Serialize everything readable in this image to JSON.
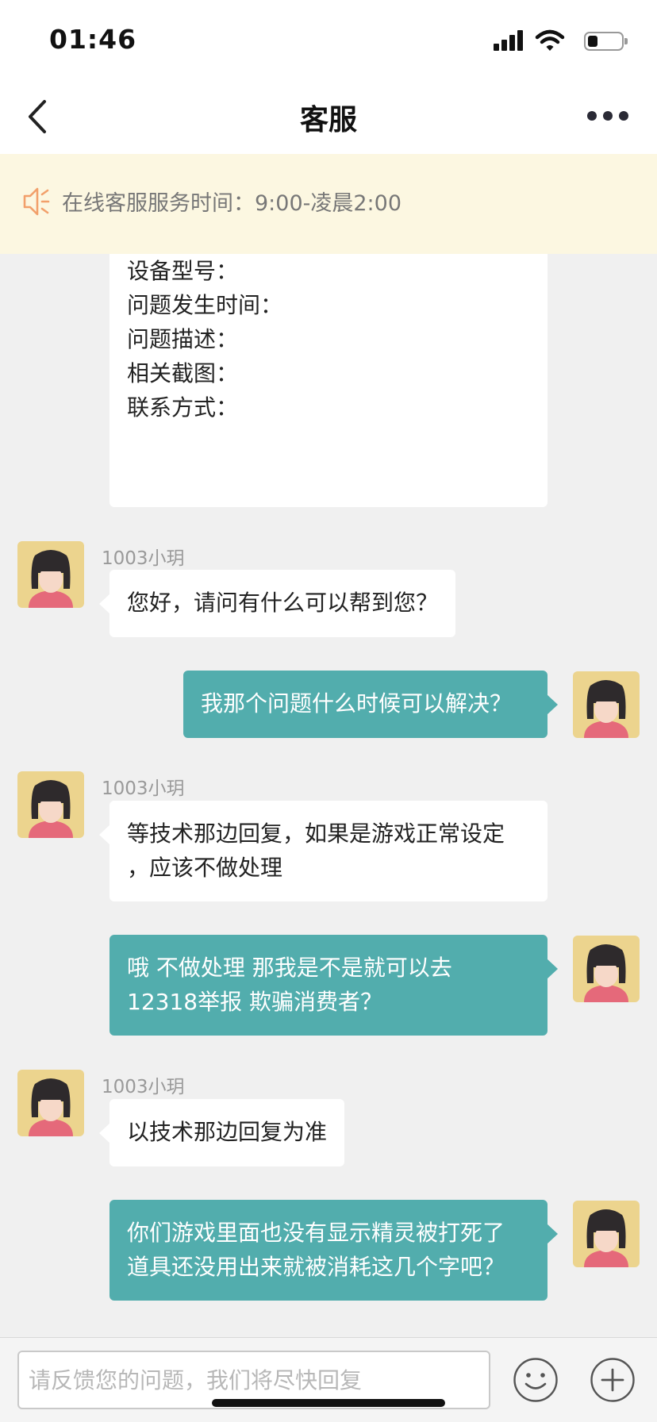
{
  "status_bar": {
    "time": "01:46",
    "battery_level": 0.25
  },
  "nav": {
    "title": "客服",
    "back_icon": "chevron-left-icon",
    "more_icon": "more-dots-icon"
  },
  "notice": {
    "icon": "speaker-icon",
    "text": "在线客服服务时间：9:00-凌晨2:00"
  },
  "colors": {
    "accent": "#52adad",
    "notice_bg": "#fcf7e1",
    "chat_bg": "#f0f0f0",
    "notice_icon": "#f2a06b"
  },
  "messages": [
    {
      "sender": "agent",
      "name": "",
      "lines": [
        "设备型号：",
        "问题发生时间：",
        "问题描述：",
        "相关截图：",
        "联系方式："
      ]
    },
    {
      "sender": "agent",
      "name": "1003小玥",
      "lines": [
        "您好，请问有什么可以帮到您？"
      ]
    },
    {
      "sender": "user",
      "name": "",
      "lines": [
        "我那个问题什么时候可以解决？"
      ]
    },
    {
      "sender": "agent",
      "name": "1003小玥",
      "lines": [
        "等技术那边回复，如果是游戏正常设定",
        "，应该不做处理"
      ]
    },
    {
      "sender": "user",
      "name": "",
      "lines": [
        "哦 不做处理 那我是不是就可以去",
        "12318举报 欺骗消费者？"
      ]
    },
    {
      "sender": "agent",
      "name": "1003小玥",
      "lines": [
        "以技术那边回复为准"
      ]
    },
    {
      "sender": "user",
      "name": "",
      "lines": [
        "你们游戏里面也没有显示精灵被打死了",
        "道具还没用出来就被消耗这几个字吧？"
      ]
    }
  ],
  "input": {
    "placeholder": "请反馈您的问题，我们将尽快回复",
    "value": "",
    "emoji_icon": "smiley-icon",
    "plus_icon": "plus-icon"
  }
}
